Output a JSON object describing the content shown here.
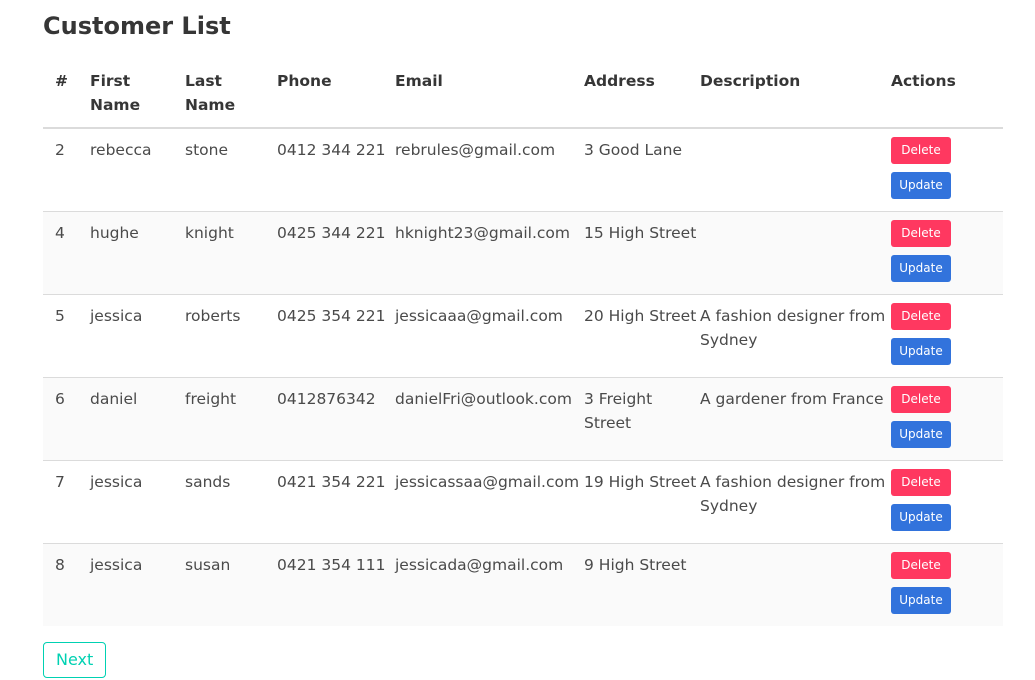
{
  "page": {
    "title": "Customer List"
  },
  "table": {
    "headers": {
      "id": "#",
      "first_name": "First Name",
      "last_name": "Last Name",
      "phone": "Phone",
      "email": "Email",
      "address": "Address",
      "description": "Description",
      "actions": "Actions"
    },
    "rows": [
      {
        "id": "2",
        "first_name": "rebecca",
        "last_name": "stone",
        "phone": "0412 344 221",
        "email": "rebrules@gmail.com",
        "address": "3 Good Lane",
        "description": ""
      },
      {
        "id": "4",
        "first_name": "hughe",
        "last_name": "knight",
        "phone": "0425 344 221",
        "email": "hknight23@gmail.com",
        "address": "15 High Street",
        "description": ""
      },
      {
        "id": "5",
        "first_name": "jessica",
        "last_name": "roberts",
        "phone": "0425 354 221",
        "email": "jessicaaa@gmail.com",
        "address": "20 High Street",
        "description": "A fashion designer from Sydney"
      },
      {
        "id": "6",
        "first_name": "daniel",
        "last_name": "freight",
        "phone": "0412876342",
        "email": "danielFri@outlook.com",
        "address": "3 Freight Street",
        "description": "A gardener from France"
      },
      {
        "id": "7",
        "first_name": "jessica",
        "last_name": "sands",
        "phone": "0421 354 221",
        "email": "jessicassaa@gmail.com",
        "address": "19 High Street",
        "description": "A fashion designer from Sydney"
      },
      {
        "id": "8",
        "first_name": "jessica",
        "last_name": "susan",
        "phone": "0421 354 111",
        "email": "jessicada@gmail.com",
        "address": "9 High Street",
        "description": ""
      }
    ],
    "delete_label": "Delete",
    "update_label": "Update"
  },
  "pagination": {
    "next_label": "Next"
  },
  "colors": {
    "delete": "#ff3860",
    "update": "#3273dc",
    "next_border": "#00d1b2"
  }
}
